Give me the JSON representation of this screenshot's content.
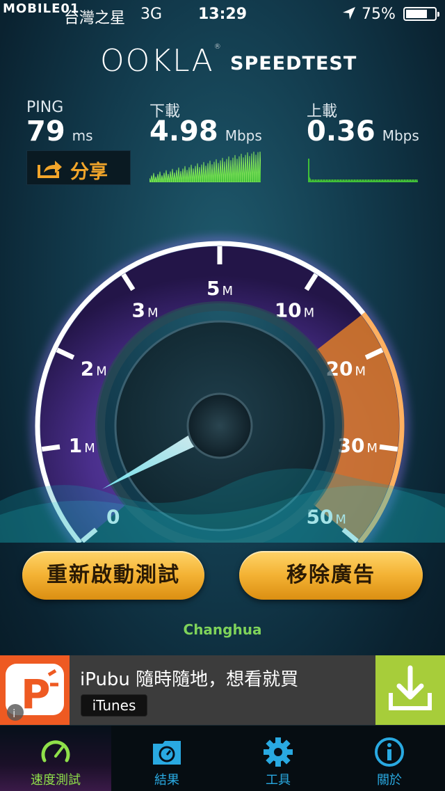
{
  "status_bar": {
    "watermark": "MOBILE01",
    "carrier": "台灣之星",
    "network": "3G",
    "time": "13:29",
    "battery_percent": "75%",
    "battery_level": 0.75
  },
  "header": {
    "logo": "OOKLA",
    "title": "SPEEDTEST"
  },
  "metrics": {
    "ping_label": "PING",
    "ping_value": "79",
    "ping_unit": "ms",
    "download_label": "下載",
    "download_value": "4.98",
    "download_unit": "Mbps",
    "upload_label": "上載",
    "upload_value": "0.36",
    "upload_unit": "Mbps"
  },
  "share": {
    "label": "分享",
    "icon": "share-icon"
  },
  "gauge": {
    "ticks": [
      {
        "num": "0",
        "unit": ""
      },
      {
        "num": "1",
        "unit": "M"
      },
      {
        "num": "2",
        "unit": "M"
      },
      {
        "num": "3",
        "unit": "M"
      },
      {
        "num": "5",
        "unit": "M"
      },
      {
        "num": "10",
        "unit": "M"
      },
      {
        "num": "20",
        "unit": "M"
      },
      {
        "num": "30",
        "unit": "M"
      },
      {
        "num": "50",
        "unit": "M"
      }
    ],
    "needle_value_mbps": 0.36,
    "accent_purple": "#7b4fd0",
    "accent_orange": "#e8872a"
  },
  "buttons": {
    "restart": "重新啟動測試",
    "remove_ads": "移除廣告"
  },
  "server": "Changhua",
  "ad": {
    "title": "iPubu 隨時隨地，想看就買",
    "store": "iTunes",
    "icon": "download-icon"
  },
  "tabs": [
    {
      "label": "速度測試",
      "icon": "speedometer-icon",
      "active": true
    },
    {
      "label": "結果",
      "icon": "results-folder-icon",
      "active": false
    },
    {
      "label": "工具",
      "icon": "gear-icon",
      "active": false
    },
    {
      "label": "關於",
      "icon": "info-icon",
      "active": false
    }
  ]
}
